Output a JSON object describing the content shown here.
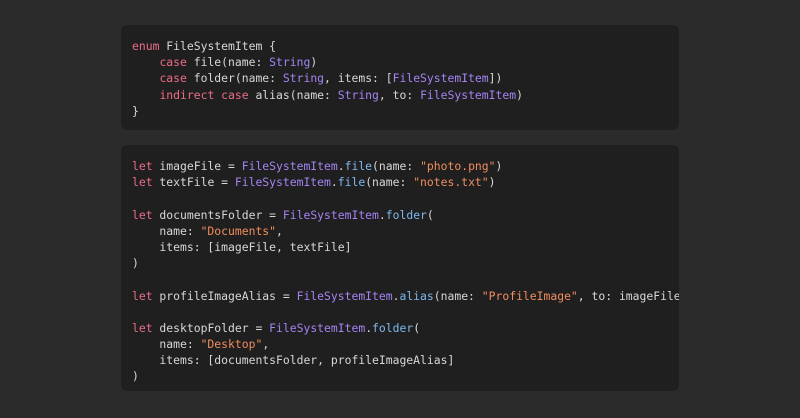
{
  "colors": {
    "background": "#2b2b2b",
    "code_background": "#1f1f1f",
    "keyword": "#ec6d88",
    "type": "#a484f2",
    "function": "#7fb8ee",
    "string": "#f08d5f",
    "plain": "#d7d7d7"
  },
  "blocks": [
    {
      "name": "enum-declaration",
      "lines": [
        [
          {
            "t": "kw",
            "v": "enum"
          },
          {
            "t": "plain",
            "v": " FileSystemItem {"
          }
        ],
        [
          {
            "t": "plain",
            "v": "    "
          },
          {
            "t": "kw",
            "v": "case"
          },
          {
            "t": "plain",
            "v": " file(name: "
          },
          {
            "t": "type",
            "v": "String"
          },
          {
            "t": "plain",
            "v": ")"
          }
        ],
        [
          {
            "t": "plain",
            "v": "    "
          },
          {
            "t": "kw",
            "v": "case"
          },
          {
            "t": "plain",
            "v": " folder(name: "
          },
          {
            "t": "type",
            "v": "String"
          },
          {
            "t": "plain",
            "v": ", items: ["
          },
          {
            "t": "type",
            "v": "FileSystemItem"
          },
          {
            "t": "plain",
            "v": "])"
          }
        ],
        [
          {
            "t": "plain",
            "v": "    "
          },
          {
            "t": "kw",
            "v": "indirect case"
          },
          {
            "t": "plain",
            "v": " alias(name: "
          },
          {
            "t": "type",
            "v": "String"
          },
          {
            "t": "plain",
            "v": ", to: "
          },
          {
            "t": "type",
            "v": "FileSystemItem"
          },
          {
            "t": "plain",
            "v": ")"
          }
        ],
        [
          {
            "t": "plain",
            "v": "}"
          }
        ]
      ]
    },
    {
      "name": "usage-examples",
      "lines": [
        [
          {
            "t": "kw",
            "v": "let"
          },
          {
            "t": "plain",
            "v": " imageFile = "
          },
          {
            "t": "type",
            "v": "FileSystemItem"
          },
          {
            "t": "plain",
            "v": "."
          },
          {
            "t": "fn",
            "v": "file"
          },
          {
            "t": "plain",
            "v": "(name: "
          },
          {
            "t": "str",
            "v": "\"photo.png\""
          },
          {
            "t": "plain",
            "v": ")"
          }
        ],
        [
          {
            "t": "kw",
            "v": "let"
          },
          {
            "t": "plain",
            "v": " textFile = "
          },
          {
            "t": "type",
            "v": "FileSystemItem"
          },
          {
            "t": "plain",
            "v": "."
          },
          {
            "t": "fn",
            "v": "file"
          },
          {
            "t": "plain",
            "v": "(name: "
          },
          {
            "t": "str",
            "v": "\"notes.txt\""
          },
          {
            "t": "plain",
            "v": ")"
          }
        ],
        [],
        [
          {
            "t": "kw",
            "v": "let"
          },
          {
            "t": "plain",
            "v": " documentsFolder = "
          },
          {
            "t": "type",
            "v": "FileSystemItem"
          },
          {
            "t": "plain",
            "v": "."
          },
          {
            "t": "fn",
            "v": "folder"
          },
          {
            "t": "plain",
            "v": "("
          }
        ],
        [
          {
            "t": "plain",
            "v": "    name: "
          },
          {
            "t": "str",
            "v": "\"Documents\""
          },
          {
            "t": "plain",
            "v": ","
          }
        ],
        [
          {
            "t": "plain",
            "v": "    items: [imageFile, textFile]"
          }
        ],
        [
          {
            "t": "plain",
            "v": ")"
          }
        ],
        [],
        [
          {
            "t": "kw",
            "v": "let"
          },
          {
            "t": "plain",
            "v": " profileImageAlias = "
          },
          {
            "t": "type",
            "v": "FileSystemItem"
          },
          {
            "t": "plain",
            "v": "."
          },
          {
            "t": "fn",
            "v": "alias"
          },
          {
            "t": "plain",
            "v": "(name: "
          },
          {
            "t": "str",
            "v": "\"ProfileImage\""
          },
          {
            "t": "plain",
            "v": ", to: imageFile)"
          }
        ],
        [],
        [
          {
            "t": "kw",
            "v": "let"
          },
          {
            "t": "plain",
            "v": " desktopFolder = "
          },
          {
            "t": "type",
            "v": "FileSystemItem"
          },
          {
            "t": "plain",
            "v": "."
          },
          {
            "t": "fn",
            "v": "folder"
          },
          {
            "t": "plain",
            "v": "("
          }
        ],
        [
          {
            "t": "plain",
            "v": "    name: "
          },
          {
            "t": "str",
            "v": "\"Desktop\""
          },
          {
            "t": "plain",
            "v": ","
          }
        ],
        [
          {
            "t": "plain",
            "v": "    items: [documentsFolder, profileImageAlias]"
          }
        ],
        [
          {
            "t": "plain",
            "v": ")"
          }
        ]
      ]
    }
  ]
}
